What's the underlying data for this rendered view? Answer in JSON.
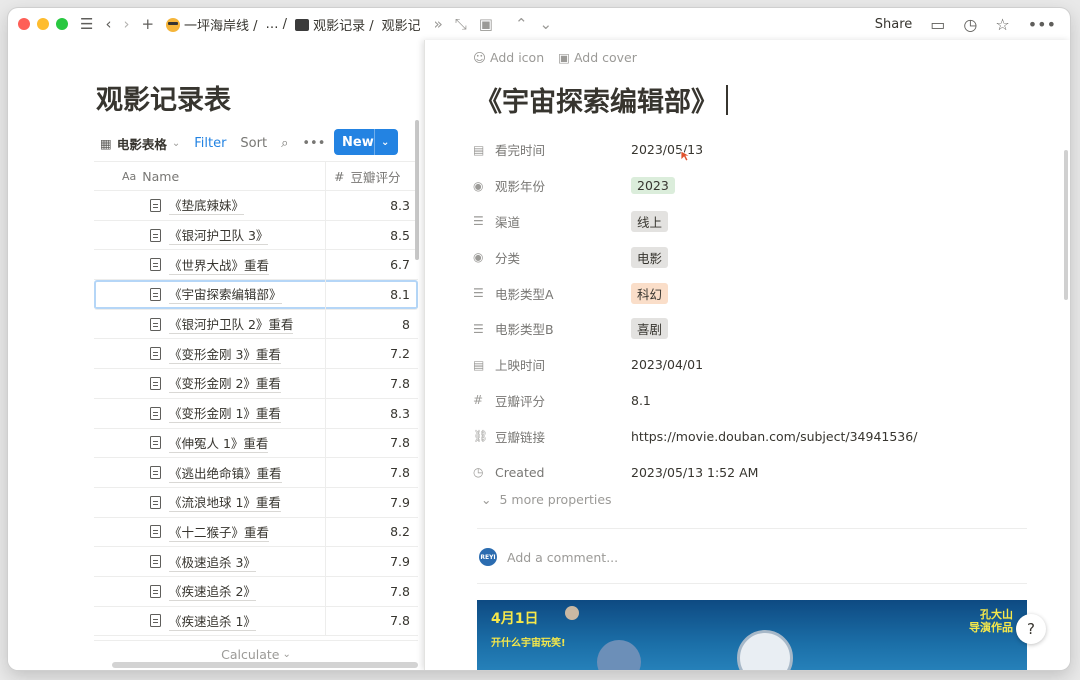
{
  "topbar": {
    "breadcrumb": [
      {
        "label": "一坪海岸线 /",
        "icon": "sunglasses-emoji-icon"
      },
      {
        "label": "… /"
      },
      {
        "label": "观影记录 /",
        "icon": "film-camera-emoji-icon"
      },
      {
        "label": "观影记录"
      }
    ],
    "share_label": "Share"
  },
  "database": {
    "title": "观影记录表",
    "view_name": "电影表格",
    "filter_label": "Filter",
    "sort_label": "Sort",
    "new_label": "New",
    "columns": {
      "name": "Name",
      "score": "豆瓣评分"
    },
    "rows": [
      {
        "name": "《垫底辣妹》",
        "score": "8.3"
      },
      {
        "name": "《银河护卫队 3》",
        "score": "8.5"
      },
      {
        "name": "《世界大战》重看",
        "score": "6.7"
      },
      {
        "name": "《宇宙探索编辑部》",
        "score": "8.1",
        "selected": true
      },
      {
        "name": "《银河护卫队 2》重看",
        "score": "8"
      },
      {
        "name": "《变形金刚 3》重看",
        "score": "7.2"
      },
      {
        "name": "《变形金刚 2》重看",
        "score": "7.8"
      },
      {
        "name": "《变形金刚 1》重看",
        "score": "8.3"
      },
      {
        "name": "《伸冤人 1》重看",
        "score": "7.8"
      },
      {
        "name": "《逃出绝命镇》重看",
        "score": "7.8"
      },
      {
        "name": "《流浪地球 1》重看",
        "score": "7.9"
      },
      {
        "name": "《十二猴子》重看",
        "score": "8.2"
      },
      {
        "name": "《极速追杀 3》",
        "score": "7.9"
      },
      {
        "name": "《疾速追杀 2》",
        "score": "7.8"
      },
      {
        "name": "《疾速追杀 1》",
        "score": "7.8"
      }
    ],
    "calculate_label": "Calculate"
  },
  "page": {
    "add_icon_label": "Add icon",
    "add_cover_label": "Add cover",
    "title": "《宇宙探索编辑部》",
    "properties": [
      {
        "icon": "calendar-icon",
        "name": "看完时间",
        "value": "2023/05/13"
      },
      {
        "icon": "select-icon",
        "name": "观影年份",
        "value": "2023",
        "tag_color": "#dbeddb"
      },
      {
        "icon": "list-icon",
        "name": "渠道",
        "value": "线上",
        "tag_color": "#e3e2e0"
      },
      {
        "icon": "select-icon",
        "name": "分类",
        "value": "电影",
        "tag_color": "#e3e2e0"
      },
      {
        "icon": "list-icon",
        "name": "电影类型A",
        "value": "科幻",
        "tag_color": "#fadec9"
      },
      {
        "icon": "list-icon",
        "name": "电影类型B",
        "value": "喜剧",
        "tag_color": "#e3e2e0"
      },
      {
        "icon": "calendar-icon",
        "name": "上映时间",
        "value": "2023/04/01"
      },
      {
        "icon": "hash-icon",
        "name": "豆瓣评分",
        "value": "8.1"
      },
      {
        "icon": "link-icon",
        "name": "豆瓣链接",
        "value": "https://movie.douban.com/subject/34941536/"
      },
      {
        "icon": "clock-icon",
        "name": "Created",
        "value": "2023/05/13 1:52 AM"
      }
    ],
    "more_properties": "5 more properties",
    "avatar_text": "REYI",
    "comment_placeholder": "Add a comment...",
    "poster": {
      "date": "4月1日",
      "tagline": "开什么宇宙玩笑!",
      "director": "孔大山\n导演作品"
    }
  },
  "help_label": "?",
  "colors": {
    "accent": "#2383e2",
    "poster": "#1b6fa8"
  }
}
